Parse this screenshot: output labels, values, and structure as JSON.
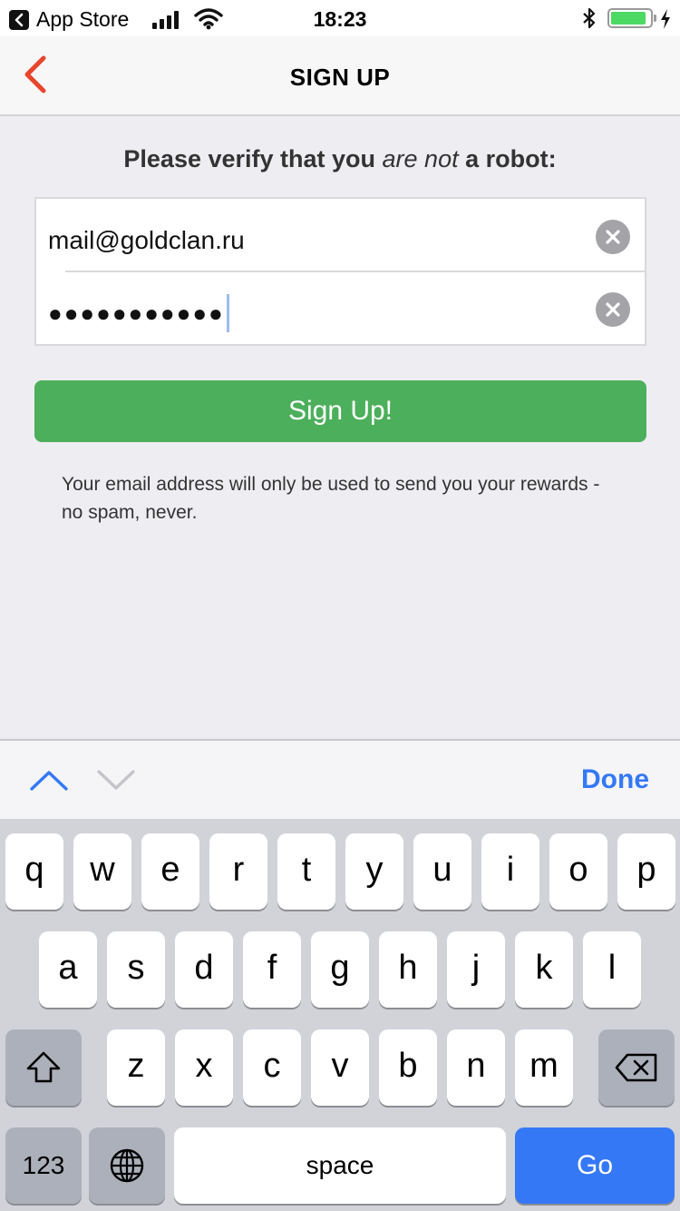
{
  "status_bar": {
    "back_app": "App Store",
    "time": "18:23",
    "battery_level": 0.9
  },
  "nav": {
    "title": "SIGN UP",
    "back_icon": "chevron-left-icon",
    "accent_color": "#e8452c"
  },
  "form": {
    "heading_pre": "Please verify that you ",
    "heading_em": "are not",
    "heading_post": " a robot:",
    "email_value": "mail@goldclan.ru",
    "password_value": "●●●●●●●●●●●",
    "clear_icon": "clear-icon"
  },
  "signup_button": {
    "label": "Sign Up!",
    "color": "#4caf5b"
  },
  "note": "Your email address will only be used to send you your rewards - no spam, never.",
  "accessory": {
    "done_label": "Done",
    "prev_icon": "chevron-up-icon",
    "next_icon": "chevron-down-icon",
    "accent_color": "#3478f6"
  },
  "keyboard": {
    "row1": [
      "q",
      "w",
      "e",
      "r",
      "t",
      "y",
      "u",
      "i",
      "o",
      "p"
    ],
    "row2": [
      "a",
      "s",
      "d",
      "f",
      "g",
      "h",
      "j",
      "k",
      "l"
    ],
    "row3": [
      "z",
      "x",
      "c",
      "v",
      "b",
      "n",
      "m"
    ],
    "numbers_label": "123",
    "space_label": "space",
    "go_label": "Go",
    "shift_icon": "shift-icon",
    "globe_icon": "globe-icon",
    "delete_icon": "backspace-icon"
  }
}
